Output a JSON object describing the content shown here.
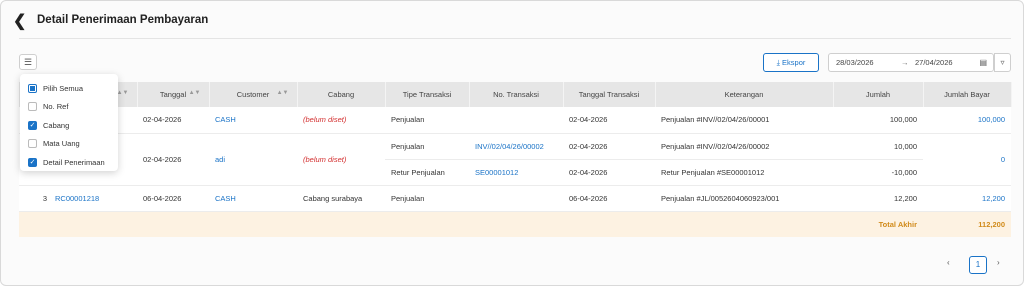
{
  "header": {
    "title": "Detail Penerimaan Pembayaran",
    "back_icon": "chevron-left-icon"
  },
  "toolbar": {
    "export_label": "Ekspor",
    "date_start": "28/03/2026",
    "date_end": "27/04/2026",
    "date_arrow": "→"
  },
  "column_menu": {
    "options": [
      {
        "label": "Pilih Semua",
        "state": "partial"
      },
      {
        "label": "No. Ref",
        "state": "unchecked"
      },
      {
        "label": "Cabang",
        "state": "checked"
      },
      {
        "label": "Mata Uang",
        "state": "unchecked"
      },
      {
        "label": "Detail Penerimaan",
        "state": "checked"
      }
    ]
  },
  "table": {
    "headers": [
      "an",
      "Tanggal",
      "Customer",
      "Cabang",
      "Tipe Transaksi",
      "No. Transaksi",
      "Tanggal Transaksi",
      "Keterangan",
      "Jumlah",
      "Jumlah Bayar"
    ],
    "rows": [
      {
        "no": "",
        "ref": "",
        "date": "02-04-2026",
        "customer": "CASH",
        "branch": "(belum diset)",
        "type": "Penjualan",
        "trx": "",
        "trx_date": "02-04-2026",
        "desc": "Penjualan #INV//02/04/26/00001",
        "amount": "100,000",
        "paid": "100,000"
      },
      {
        "no": "",
        "ref": "",
        "date": "02-04-2026",
        "customer": "adi",
        "branch": "(belum diset)",
        "type": "Penjualan",
        "trx": "INV//02/04/26/00002",
        "trx_date": "02-04-2026",
        "desc": "Penjualan #INV//02/04/26/00002",
        "amount": "10,000",
        "paid": "0"
      },
      {
        "type": "Retur Penjualan",
        "trx": "SE00001012",
        "trx_date": "02-04-2026",
        "desc": "Retur Penjualan #SE00001012",
        "amount": "-10,000"
      },
      {
        "no": "3",
        "ref": "RC00001218",
        "date": "06-04-2026",
        "customer": "CASH",
        "branch": "Cabang surabaya",
        "type": "Penjualan",
        "trx": "",
        "trx_date": "06-04-2026",
        "desc": "Penjualan #JL/0052604060923/001",
        "amount": "12,200",
        "paid": "12,200"
      }
    ],
    "total_label": "Total Akhir",
    "total_value": "112,200"
  },
  "pager": {
    "page": "1",
    "prev": "‹",
    "next": "›"
  }
}
